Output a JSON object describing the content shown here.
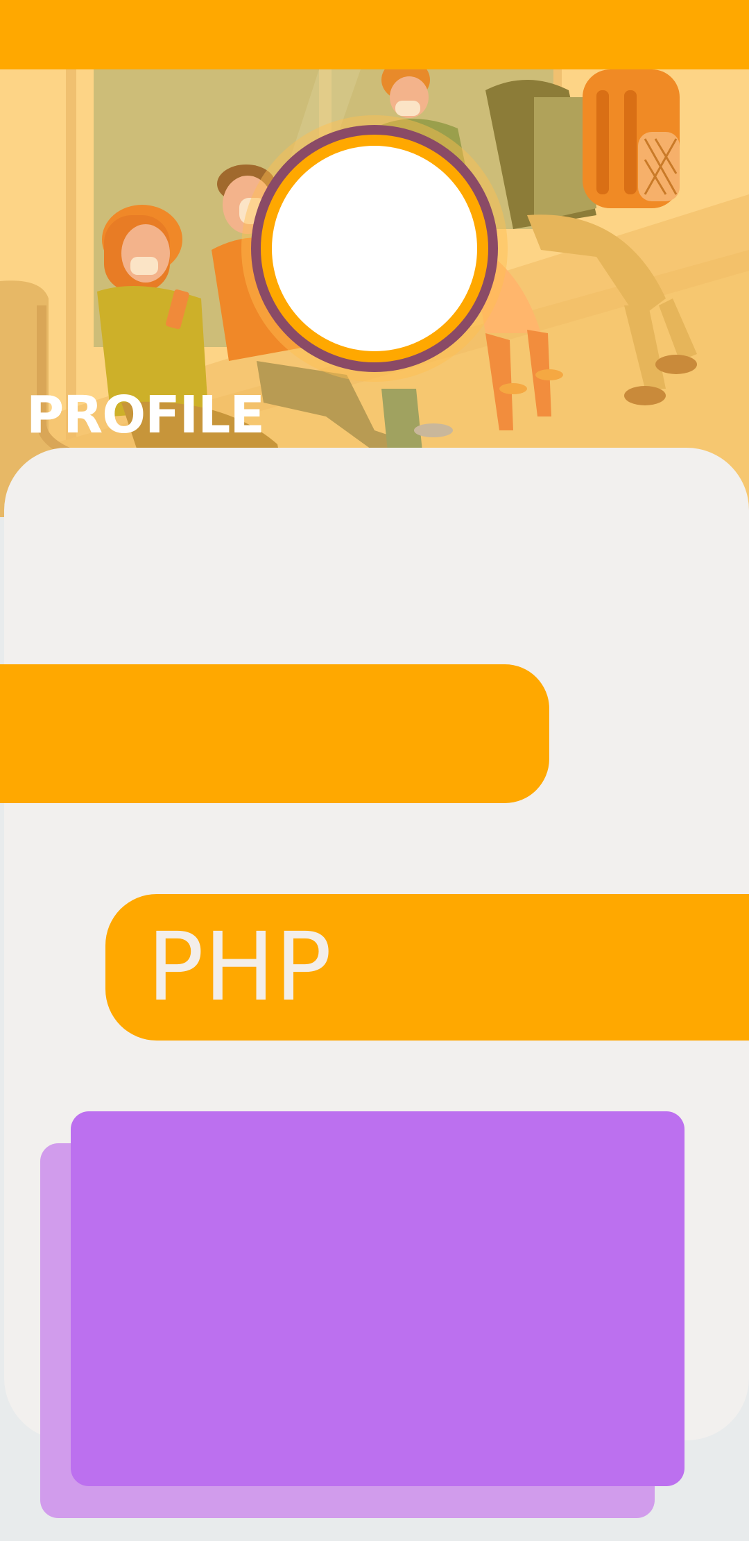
{
  "header": {
    "title": "PROFILE",
    "accent_color": "#ffa800"
  },
  "profile": {
    "avatar_icon": "avatar-placeholder-icon"
  },
  "skills": {
    "items": [
      {
        "label": ""
      },
      {
        "label": "PHP"
      }
    ]
  },
  "cards": {
    "primary_color": "#bc70ef",
    "secondary_color": "#d19cec"
  }
}
